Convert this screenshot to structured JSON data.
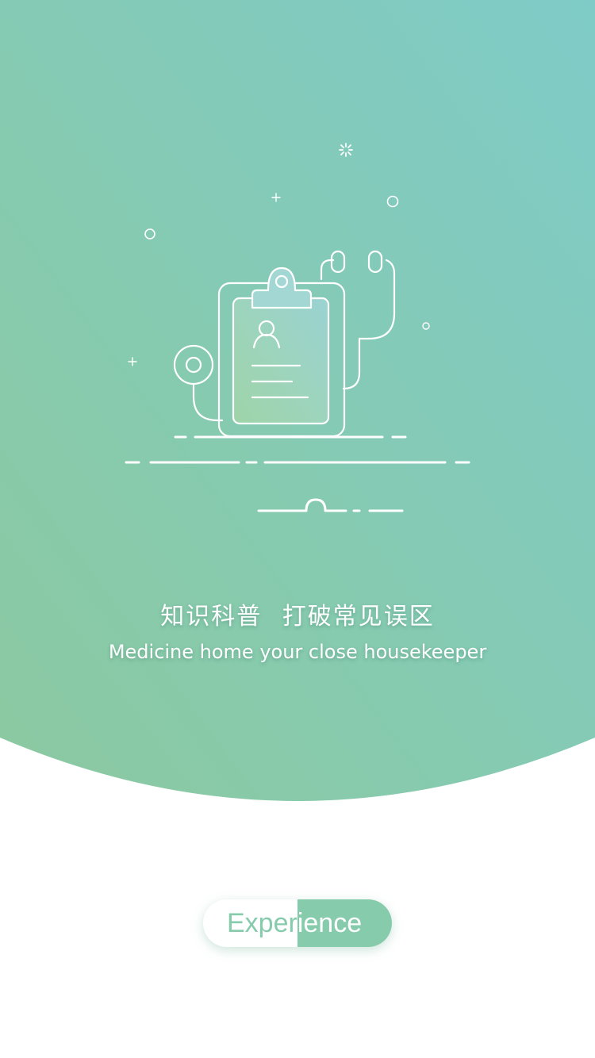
{
  "hero": {
    "colors": {
      "gradient_top_right": "#7fcbc6",
      "gradient_bottom_left": "#8ac8a4",
      "line": "#ffffff"
    },
    "icons": {
      "main": "clipboard-stethoscope-icon",
      "decor": [
        "sparkle-icon",
        "plus-icon",
        "circle-icon"
      ]
    },
    "headline": "知识科普  打破常见误区",
    "subline": "Medicine home your close housekeeper"
  },
  "cta": {
    "label": "Experience",
    "progress_fraction": 0.5,
    "accent_color": "#86cbac"
  }
}
